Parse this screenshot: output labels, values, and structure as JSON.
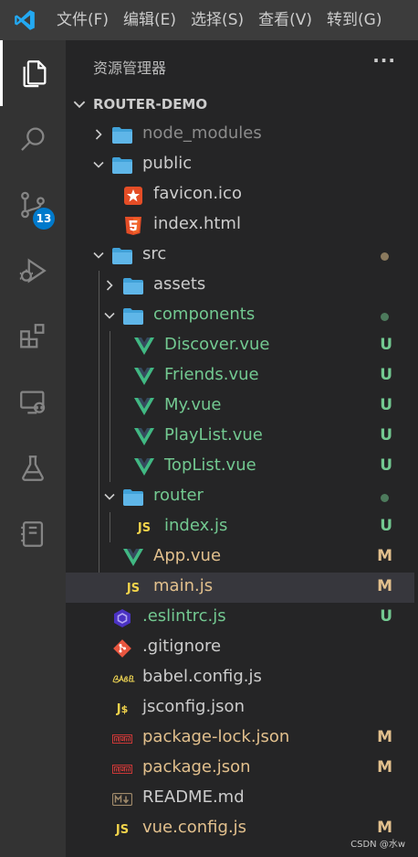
{
  "menubar": {
    "items": [
      "文件(F)",
      "编辑(E)",
      "选择(S)",
      "查看(V)",
      "转到(G)"
    ]
  },
  "activity": {
    "scm_badge": "13"
  },
  "explorer": {
    "title": "资源管理器",
    "more": "···",
    "project": "ROUTER-DEMO",
    "rows": [
      {
        "name": "node_modules",
        "status": ""
      },
      {
        "name": "public",
        "status": ""
      },
      {
        "name": "favicon.ico",
        "status": ""
      },
      {
        "name": "index.html",
        "status": ""
      },
      {
        "name": "src",
        "status": ""
      },
      {
        "name": "assets",
        "status": ""
      },
      {
        "name": "components",
        "status": ""
      },
      {
        "name": "Discover.vue",
        "status": "U"
      },
      {
        "name": "Friends.vue",
        "status": "U"
      },
      {
        "name": "My.vue",
        "status": "U"
      },
      {
        "name": "PlayList.vue",
        "status": "U"
      },
      {
        "name": "TopList.vue",
        "status": "U"
      },
      {
        "name": "router",
        "status": ""
      },
      {
        "name": "index.js",
        "status": "U"
      },
      {
        "name": "App.vue",
        "status": "M"
      },
      {
        "name": "main.js",
        "status": "M"
      },
      {
        "name": ".eslintrc.js",
        "status": "U"
      },
      {
        "name": ".gitignore",
        "status": ""
      },
      {
        "name": "babel.config.js",
        "status": ""
      },
      {
        "name": "jsconfig.json",
        "status": ""
      },
      {
        "name": "package-lock.json",
        "status": "M"
      },
      {
        "name": "package.json",
        "status": "M"
      },
      {
        "name": "README.md",
        "status": ""
      },
      {
        "name": "vue.config.js",
        "status": "M"
      }
    ]
  },
  "colors": {
    "untracked": "#73c991",
    "modified": "#e2c08d",
    "ignored": "#8c8c8c",
    "default": "#cccccc"
  },
  "watermark": "CSDN @水w"
}
